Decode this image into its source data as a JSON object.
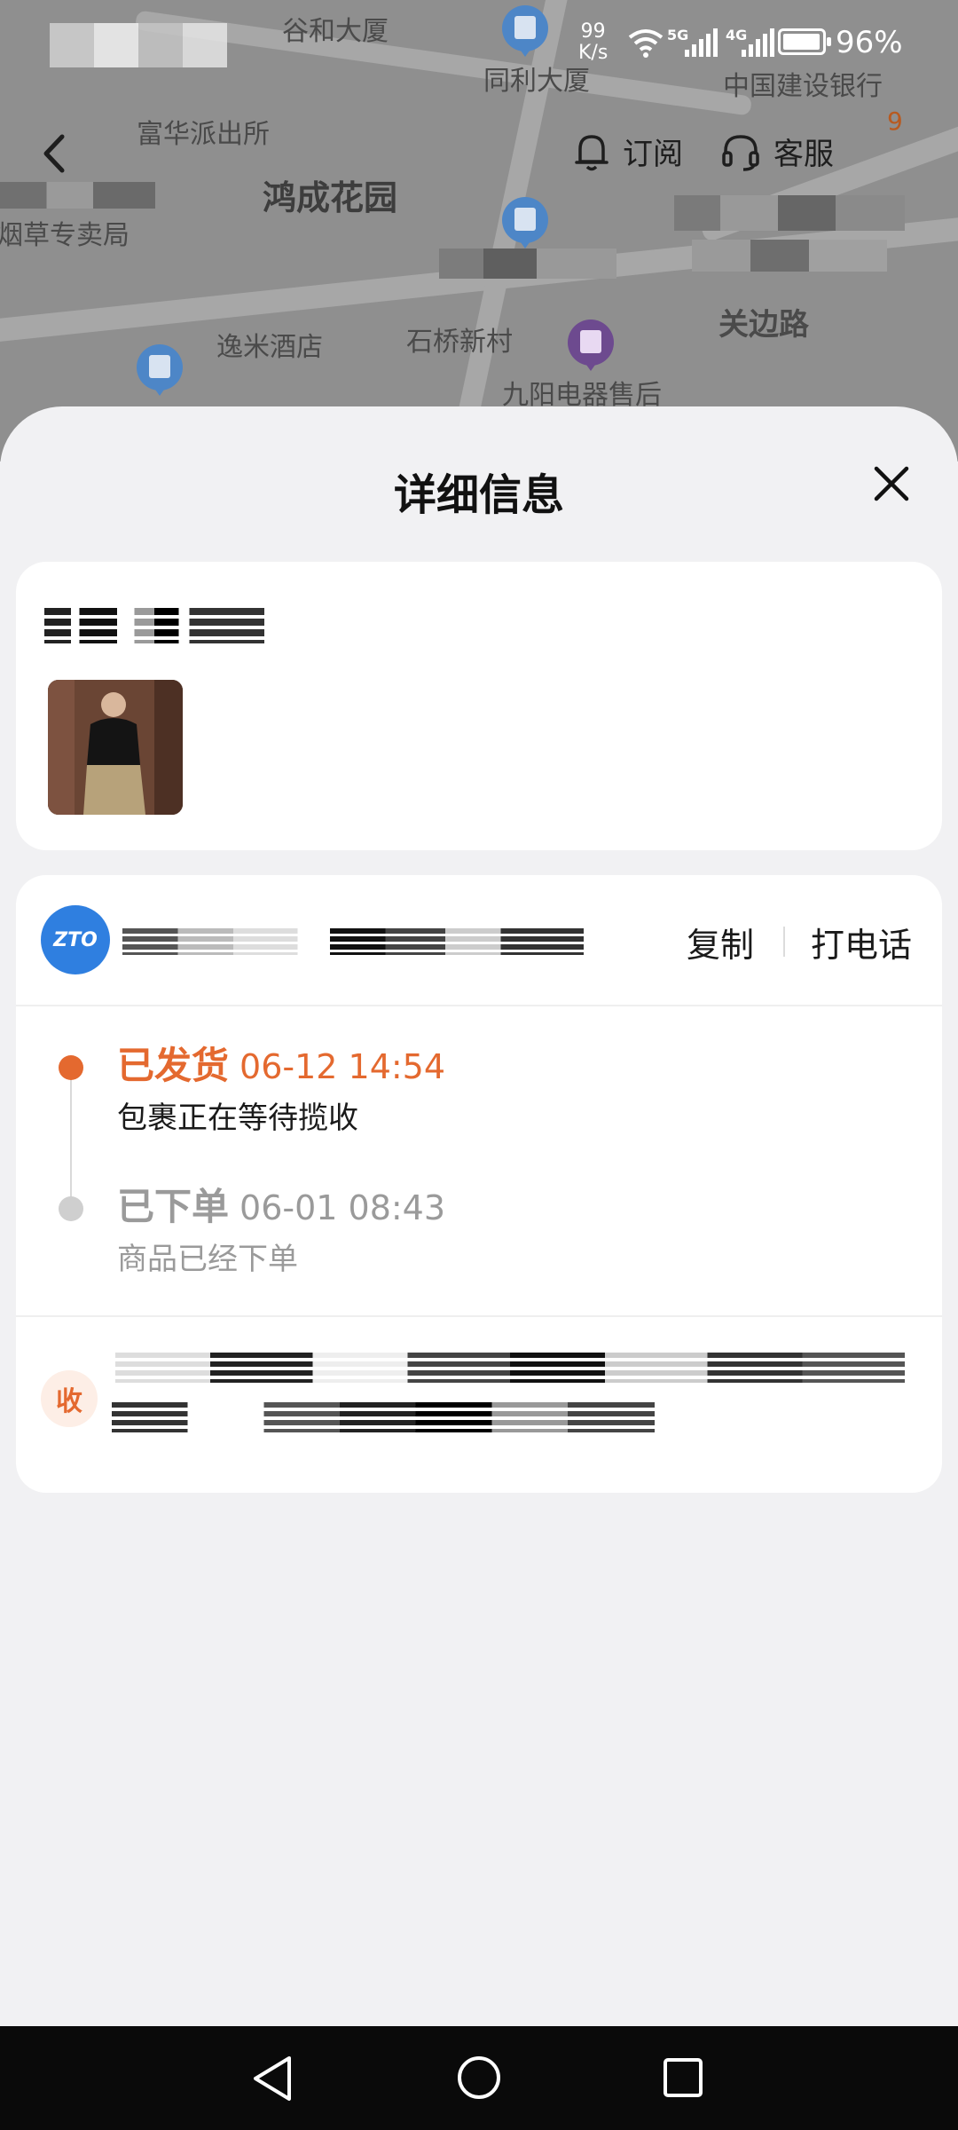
{
  "status_bar": {
    "net_speed_value": "99",
    "net_speed_unit": "K/s",
    "net1": "5G",
    "net2": "4G",
    "battery": "96%"
  },
  "map": {
    "labels": [
      "富华派出所",
      "鸿成花园",
      "烟草专卖局",
      "中国建设银行",
      "同利大厦",
      "谷和大厦",
      "逸米酒店",
      "石桥新村",
      "九阳电器售后",
      "关边路"
    ],
    "corner_number": "9"
  },
  "top_nav": {
    "subscribe_label": "订阅",
    "service_label": "客服"
  },
  "sheet": {
    "title": "详细信息"
  },
  "courier": {
    "logo_text": "ZTO",
    "copy_label": "复制",
    "call_label": "打电话"
  },
  "tracking": [
    {
      "status": "已发货",
      "time": "06-12 14:54",
      "desc": "包裹正在等待揽收",
      "active": true
    },
    {
      "status": "已下单",
      "time": "06-01 08:43",
      "desc": "商品已经下单",
      "active": false
    }
  ],
  "receiver": {
    "badge": "收"
  },
  "colors": {
    "accent": "#e4692f",
    "inactive": "#9a9a9a",
    "courier_blue": "#2f7fe0"
  }
}
